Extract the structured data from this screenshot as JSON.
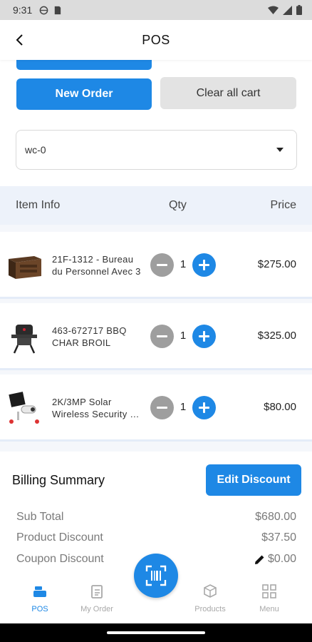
{
  "status_bar": {
    "time": "9:31"
  },
  "app_bar": {
    "title": "POS"
  },
  "actions": {
    "new_order_label": "New Order",
    "clear_cart_label": "Clear all cart"
  },
  "customer_select": {
    "selected": "wc-0"
  },
  "table_header": {
    "item_info": "Item Info",
    "qty": "Qty",
    "price": "Price"
  },
  "cart_items": [
    {
      "name": "21F-1312 - Bureau du Personnel Avec 3 …",
      "qty": "1",
      "price": "$275.00",
      "thumb_icon": "desk-image"
    },
    {
      "name": "463-672717 BBQ CHAR BROIL",
      "qty": "1",
      "price": "$325.00",
      "thumb_icon": "bbq-grill-image"
    },
    {
      "name": "2K/3MP Solar Wireless Security …",
      "qty": "1",
      "price": "$80.00",
      "thumb_icon": "security-camera-image"
    }
  ],
  "billing": {
    "title": "Billing Summary",
    "edit_discount_label": "Edit Discount",
    "sub_total_label": "Sub Total",
    "sub_total_value": "$680.00",
    "product_discount_label": "Product Discount",
    "product_discount_value": "$37.50",
    "coupon_discount_label": "Coupon Discount",
    "coupon_discount_value": "$0.00"
  },
  "bottom_nav": {
    "items": [
      {
        "label": "POS",
        "icon": "cashier-icon",
        "active": true
      },
      {
        "label": "My Order",
        "icon": "clipboard-icon",
        "active": false
      },
      {
        "label": "Products",
        "icon": "box-icon",
        "active": false
      },
      {
        "label": "Menu",
        "icon": "grid-icon",
        "active": false
      }
    ],
    "scan_icon": "barcode-scan-icon"
  },
  "colors": {
    "accent": "#1e88e5",
    "secondary_button": "#e3e3e3",
    "header_bg": "#edf2fa",
    "muted_text": "#7a7a7a"
  }
}
